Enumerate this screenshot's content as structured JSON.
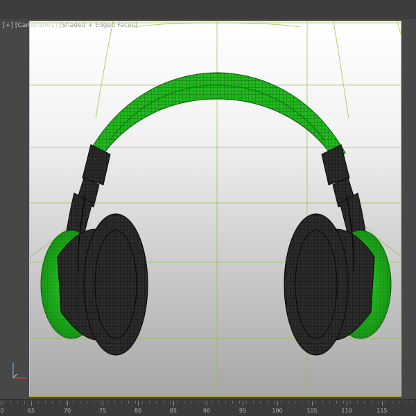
{
  "viewport": {
    "menu_bracket": "[+]",
    "camera": "[Camera001]",
    "shading_mode": "[Shaded + Edged Faces]"
  },
  "scene": {
    "object": "headphones",
    "shell_color": "#22c21f",
    "mesh_color": "#151515",
    "wire_color": "#0a0a0a",
    "guide_color": "#8fc23a",
    "safe_frame_color": "#d8d24a"
  },
  "gizmo": {
    "icon": "axis-tripod-icon",
    "y_color": "#5aa0e0",
    "x_color": "#d23a3a"
  },
  "timeline": {
    "labels": [
      "0",
      "65",
      "70",
      "75",
      "80",
      "85",
      "90",
      "95",
      "100",
      "105",
      "110",
      "115"
    ]
  }
}
